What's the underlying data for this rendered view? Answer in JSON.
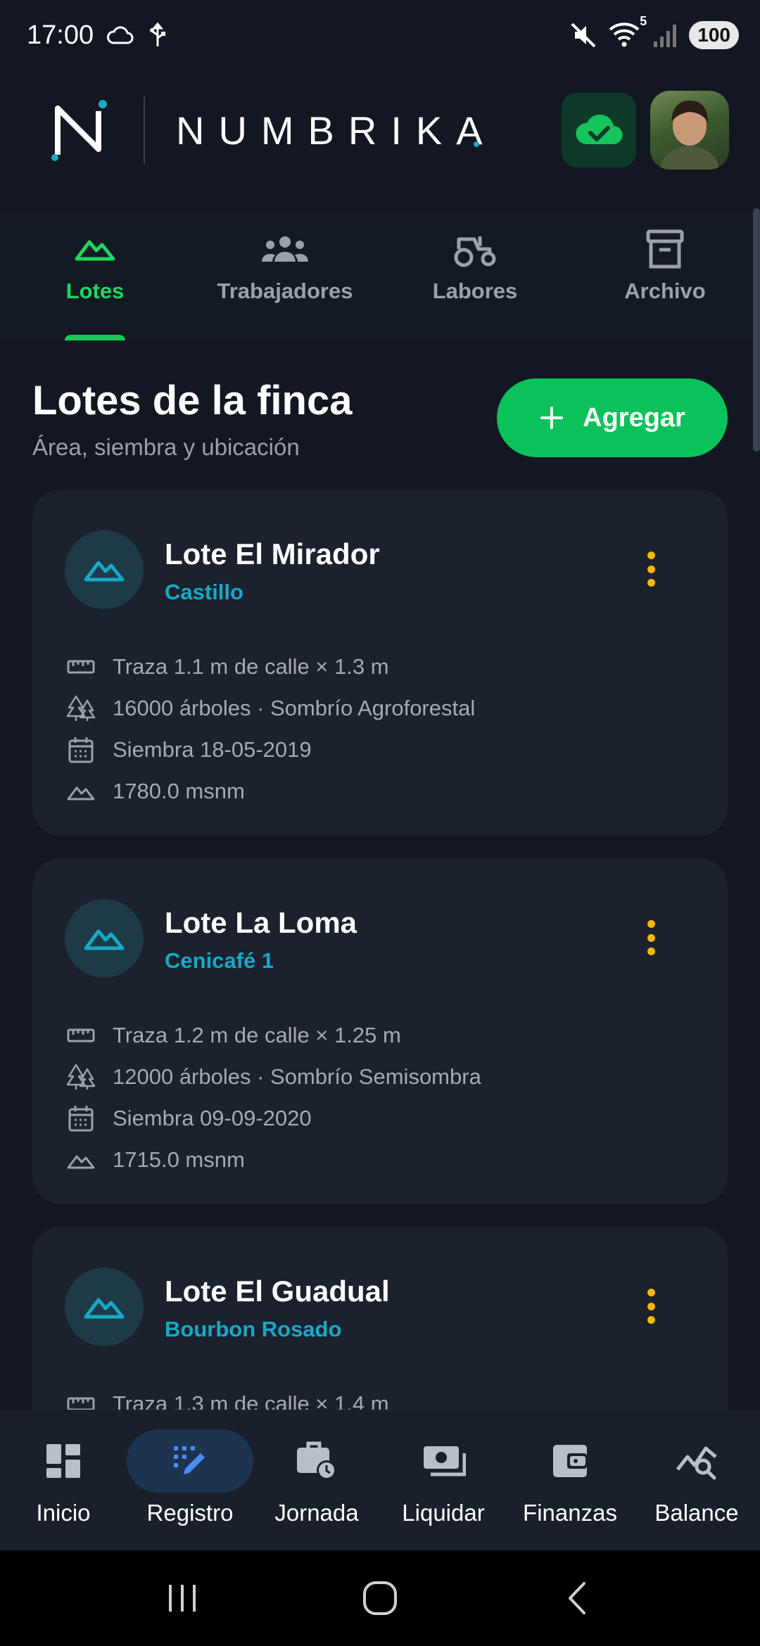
{
  "status_bar": {
    "time": "17:00",
    "battery": "100",
    "network_badge": "5"
  },
  "header": {
    "brand": "NUMBRIKA",
    "sync_status_icon": "cloud-check-icon",
    "avatar_icon": "user-avatar"
  },
  "tabs": [
    {
      "label": "Lotes",
      "icon": "mountain-icon",
      "active": true
    },
    {
      "label": "Trabajadores",
      "icon": "group-icon",
      "active": false
    },
    {
      "label": "Labores",
      "icon": "tractor-icon",
      "active": false
    },
    {
      "label": "Archivo",
      "icon": "archive-icon",
      "active": false
    }
  ],
  "section": {
    "title": "Lotes de la finca",
    "subtitle": "Área, siembra y ubicación",
    "add_label": "Agregar"
  },
  "lots": [
    {
      "name": "Lote El Mirador",
      "variety": "Castillo",
      "spacing": "Traza 1.1 m de calle × 1.3 m",
      "trees": "16000 árboles · Sombrío Agroforestal",
      "sowing": "Siembra 18-05-2019",
      "altitude": "1780.0 msnm"
    },
    {
      "name": "Lote La Loma",
      "variety": "Cenicafé 1",
      "spacing": "Traza 1.2 m de calle × 1.25 m",
      "trees": "12000 árboles · Sombrío Semisombra",
      "sowing": "Siembra 09-09-2020",
      "altitude": "1715.0 msnm"
    },
    {
      "name": "Lote El Guadual",
      "variety": "Bourbon Rosado",
      "spacing": "Traza 1.3 m de calle × 1.4 m"
    }
  ],
  "bottom_nav": [
    {
      "label": "Inicio",
      "icon": "dashboard-icon",
      "active": false
    },
    {
      "label": "Registro",
      "icon": "edit-note-icon",
      "active": true
    },
    {
      "label": "Jornada",
      "icon": "work-history-icon",
      "active": false
    },
    {
      "label": "Liquidar",
      "icon": "payments-icon",
      "active": false
    },
    {
      "label": "Finanzas",
      "icon": "wallet-icon",
      "active": false
    },
    {
      "label": "Balance",
      "icon": "query-stats-icon",
      "active": false
    }
  ],
  "colors": {
    "background": "#121722",
    "card": "#1b212d",
    "accent_green": "#0ac25a",
    "accent_cyan": "#15a9c8",
    "menu_dots": "#f5b800"
  }
}
